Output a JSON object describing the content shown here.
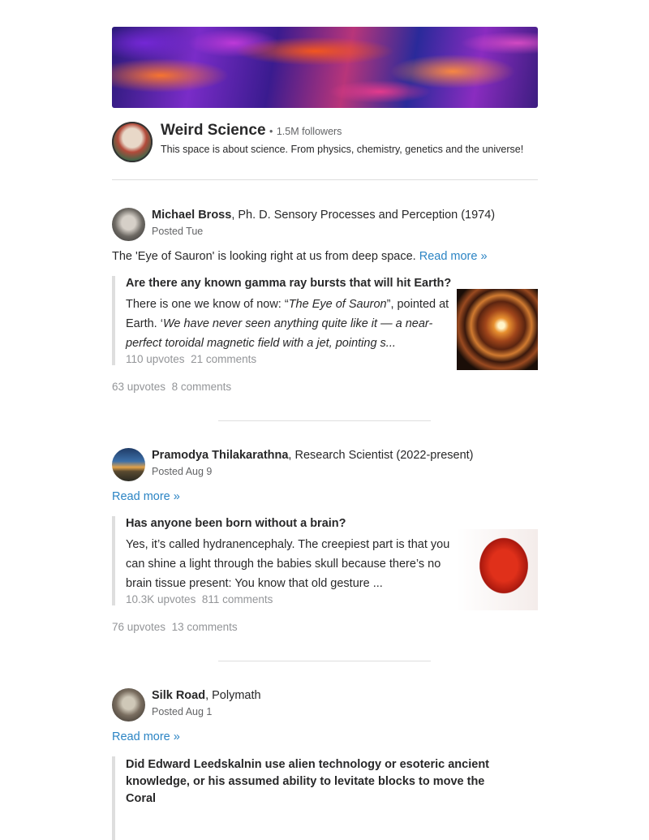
{
  "space": {
    "name": "Weird Science",
    "dot": "•",
    "followers": "1.5M followers",
    "description": "This space is about science. From physics, chemistry, genetics and the universe!"
  },
  "posts": [
    {
      "author": "Michael Bross",
      "credential": ", Ph. D. Sensory Processes and Perception (1974)",
      "posted": "Posted Tue",
      "lead": "The 'Eye of Sauron' is looking right at us from deep space.",
      "read_more": "Read more »",
      "question": "Are there any known gamma ray bursts that will hit Earth?",
      "excerpt_plain1": "There is one we know of now: “",
      "excerpt_italic1": "The Eye of Sauron",
      "excerpt_plain2": "”, pointed at Earth. ‘",
      "excerpt_italic2": "We have never seen anything quite like it — a near-perfect toroidal magnetic field with a jet, pointing s...",
      "q_upvotes": "110 upvotes",
      "q_comments": "21 comments",
      "upvotes": "63 upvotes",
      "comments": "8 comments"
    },
    {
      "author": "Pramodya Thilakarathna",
      "credential": ", Research Scientist (2022-present)",
      "posted": "Posted Aug 9",
      "read_more": "Read more »",
      "question": "Has anyone been born without a brain?",
      "excerpt": "Yes, it’s called hydranencephaly. The creepiest part is that you can shine a light through the babies skull because there’s no brain tissue present: You know that old gesture ...",
      "q_upvotes": "10.3K upvotes",
      "q_comments": "811 comments",
      "upvotes": "76 upvotes",
      "comments": "13 comments"
    },
    {
      "author": "Silk Road",
      "credential": ", Polymath",
      "posted": "Posted Aug 1",
      "read_more": "Read more »",
      "question": "Did Edward Leedskalnin use alien technology or esoteric ancient knowledge, or his assumed ability to levitate blocks to move the Coral"
    }
  ]
}
